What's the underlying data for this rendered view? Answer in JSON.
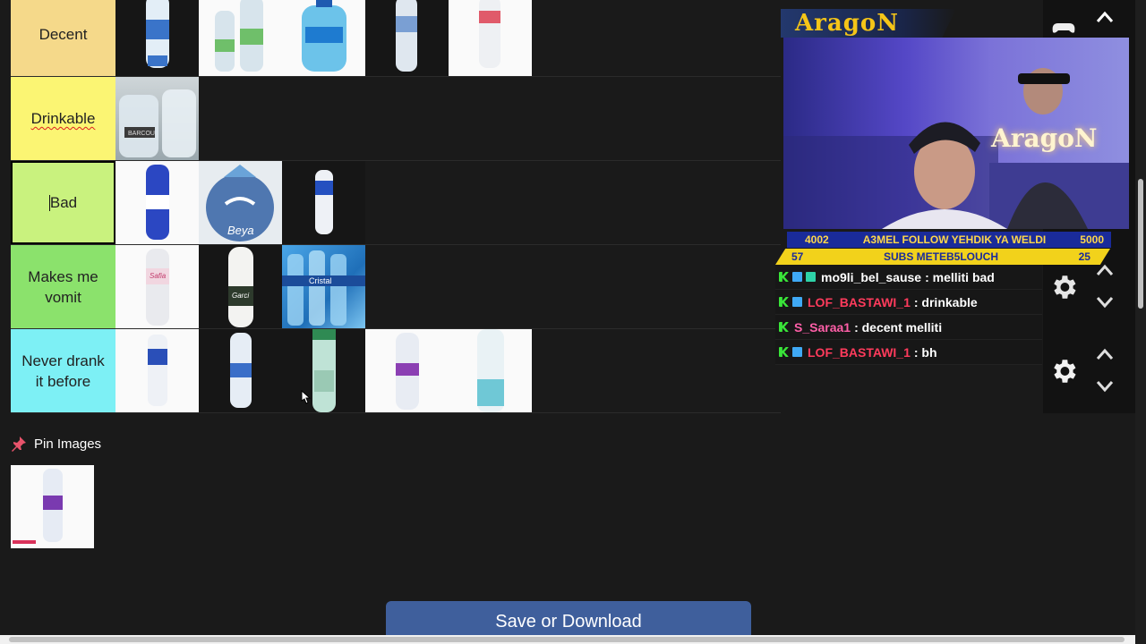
{
  "tiers": [
    {
      "label": "Decent",
      "color": "#f5d98a",
      "items": [
        "white",
        "white",
        "white",
        "white",
        "white"
      ]
    },
    {
      "label": "Drinkable",
      "color": "#fbf573",
      "items": [
        "photo"
      ]
    },
    {
      "label": "Bad",
      "color": "#c9f27e",
      "items": [
        "white",
        "beya",
        "white"
      ]
    },
    {
      "label": "Makes me vomit",
      "color": "#8be26c",
      "items": [
        "white",
        "white",
        "pack"
      ]
    },
    {
      "label": "Never drank it before",
      "color": "#7df0f5",
      "items": [
        "white",
        "white",
        "white",
        "white",
        "white"
      ]
    }
  ],
  "tile_texts": {
    "barcou": "BARCOU",
    "beya": "Beya",
    "safia": "Safia",
    "garci": "Garci",
    "cristal": "Cristal"
  },
  "pin": {
    "title": "Pin Images"
  },
  "save_label": "Save or Download",
  "overlay": {
    "logo": "AragoN",
    "webcam_sign": "AragoN",
    "stats_top": {
      "left": "4002",
      "center": "A3MEL FOLLOW YEHDIK YA WELDI",
      "right": "5000"
    },
    "stats_bottom": {
      "left": "57",
      "center": "SUBS METEB5LOUCH",
      "right": "25"
    },
    "chat": [
      {
        "user": "mo9li_bel_sause",
        "text": ": melliti bad",
        "user_color": "#ffffff"
      },
      {
        "user": "LOF_BASTAWI_1",
        "text": ": drinkable",
        "user_color": "#ff3b5c"
      },
      {
        "user": "S_Saraa1",
        "text": ": decent melliti",
        "user_color": "#ff5fa8"
      },
      {
        "user": "LOF_BASTAWI_1",
        "text": ": bh",
        "user_color": "#ff3b5c"
      }
    ]
  }
}
